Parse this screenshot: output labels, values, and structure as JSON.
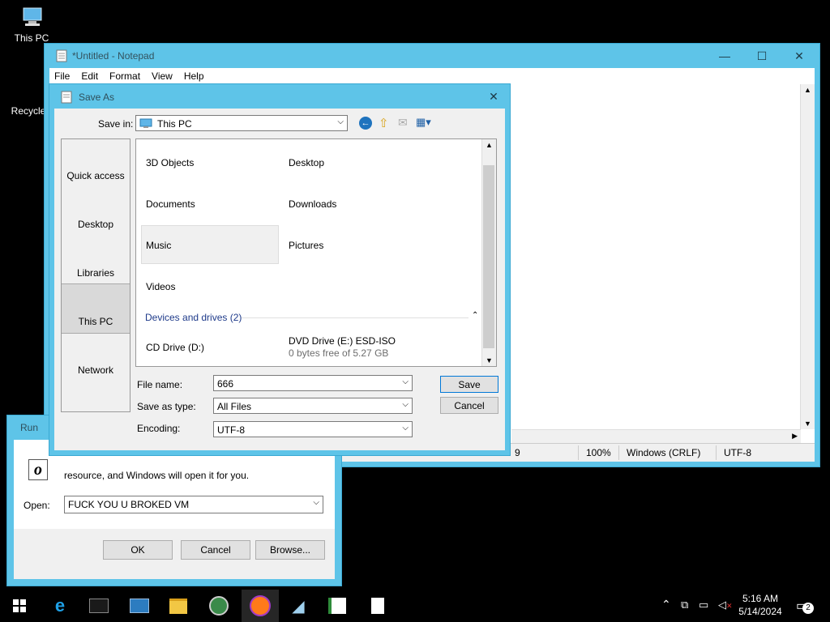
{
  "desktop": {
    "icons": [
      {
        "label": "This PC"
      },
      {
        "label": "Recycle"
      }
    ]
  },
  "notepad": {
    "title": "*Untitled - Notepad",
    "menu": [
      "File",
      "Edit",
      "Format",
      "View",
      "Help"
    ],
    "status": {
      "position": "9",
      "zoom": "100%",
      "line_ending": "Windows (CRLF)",
      "encoding": "UTF-8"
    },
    "buttons": {
      "minimize": "—",
      "maximize": "☐",
      "close": "✕"
    }
  },
  "save_as": {
    "title": "Save As",
    "save_in_label": "Save in:",
    "save_in_value": "This PC",
    "places": [
      "Quick access",
      "Desktop",
      "Libraries",
      "This PC",
      "Network"
    ],
    "selected_place": "This PC",
    "folders": [
      "3D Objects",
      "Desktop",
      "Documents",
      "Downloads",
      "Music",
      "Pictures",
      "Videos"
    ],
    "devices_header": "Devices and drives (2)",
    "drives": [
      {
        "name": "CD Drive (D:)",
        "detail": ""
      },
      {
        "name": "DVD Drive (E:) ESD-ISO",
        "detail": "0 bytes free of 5.27 GB"
      }
    ],
    "file_name_label": "File name:",
    "file_name_value": "666",
    "save_as_type_label": "Save as type:",
    "save_as_type_value": "All Files",
    "encoding_label": "Encoding:",
    "encoding_value": "UTF-8",
    "save_button": "Save",
    "cancel_button": "Cancel"
  },
  "run": {
    "title": "Run",
    "description": "resource, and Windows will open it for you.",
    "open_label": "Open:",
    "open_value": "FUCK YOU U BROKED VM",
    "ok_button": "OK",
    "cancel_button": "Cancel",
    "browse_button": "Browse..."
  },
  "taskbar": {
    "icons": [
      "start-icon",
      "internet-explorer-icon",
      "command-prompt-icon",
      "server-manager-icon",
      "file-explorer-icon",
      "network-globe-icon",
      "firefox-icon",
      "feather-app-icon",
      "spreadsheet-app-icon",
      "notepad-document-icon"
    ],
    "clock_time": "5:16 AM",
    "clock_date": "5/14/2024",
    "notification_count": "2"
  },
  "colors": {
    "window_accent": "#5ec4e8",
    "desktop": "#000000"
  }
}
